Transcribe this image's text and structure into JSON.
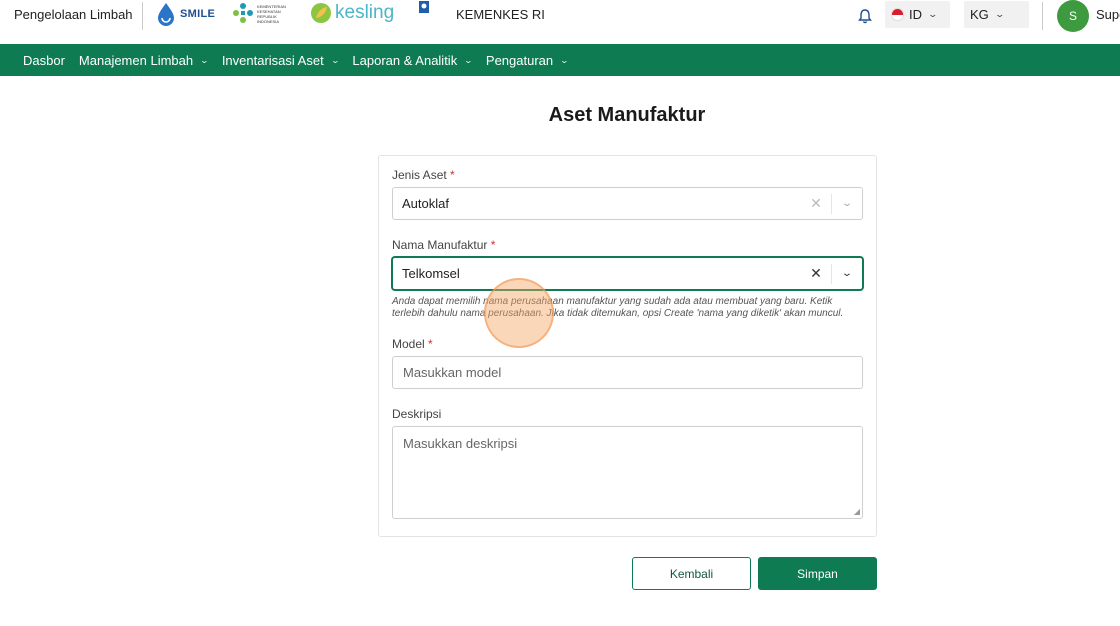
{
  "header": {
    "app_title": "Pengelolaan Limbah",
    "logos": {
      "smile": "SMILE",
      "kemenkes": "KEMENTERIAN KESEHATAN REPUBLIK INDONESIA",
      "kesling": "kesling"
    },
    "org_name": "KEMENKES RI",
    "language": "ID",
    "unit": "KG",
    "user_initial": "S",
    "user_name": "Supe"
  },
  "nav": {
    "items": [
      {
        "label": "Dasbor",
        "has_dropdown": false
      },
      {
        "label": "Manajemen Limbah",
        "has_dropdown": true
      },
      {
        "label": "Inventarisasi Aset",
        "has_dropdown": true
      },
      {
        "label": "Laporan & Analitik",
        "has_dropdown": true
      },
      {
        "label": "Pengaturan",
        "has_dropdown": true
      }
    ]
  },
  "page": {
    "title": "Aset Manufaktur"
  },
  "form": {
    "asset_type": {
      "label": "Jenis Aset",
      "required_mark": "*",
      "value": "Autoklaf"
    },
    "manufacturer": {
      "label": "Nama Manufaktur",
      "required_mark": "*",
      "value": "Telkomsel",
      "help": "Anda dapat memilih nama perusahaan manufaktur yang sudah ada atau membuat yang baru. Ketik terlebih dahulu nama perusahaan. Jika tidak ditemukan, opsi Create 'nama yang diketik' akan muncul."
    },
    "model": {
      "label": "Model",
      "required_mark": "*",
      "placeholder": "Masukkan model"
    },
    "description": {
      "label": "Deskripsi",
      "placeholder": "Masukkan deskripsi"
    },
    "back_label": "Kembali",
    "save_label": "Simpan"
  },
  "colors": {
    "brand_green": "#0e7b53",
    "avatar_green": "#3d9a3f",
    "required_red": "#d32f2f",
    "touch_indicator": "#f6a664"
  }
}
